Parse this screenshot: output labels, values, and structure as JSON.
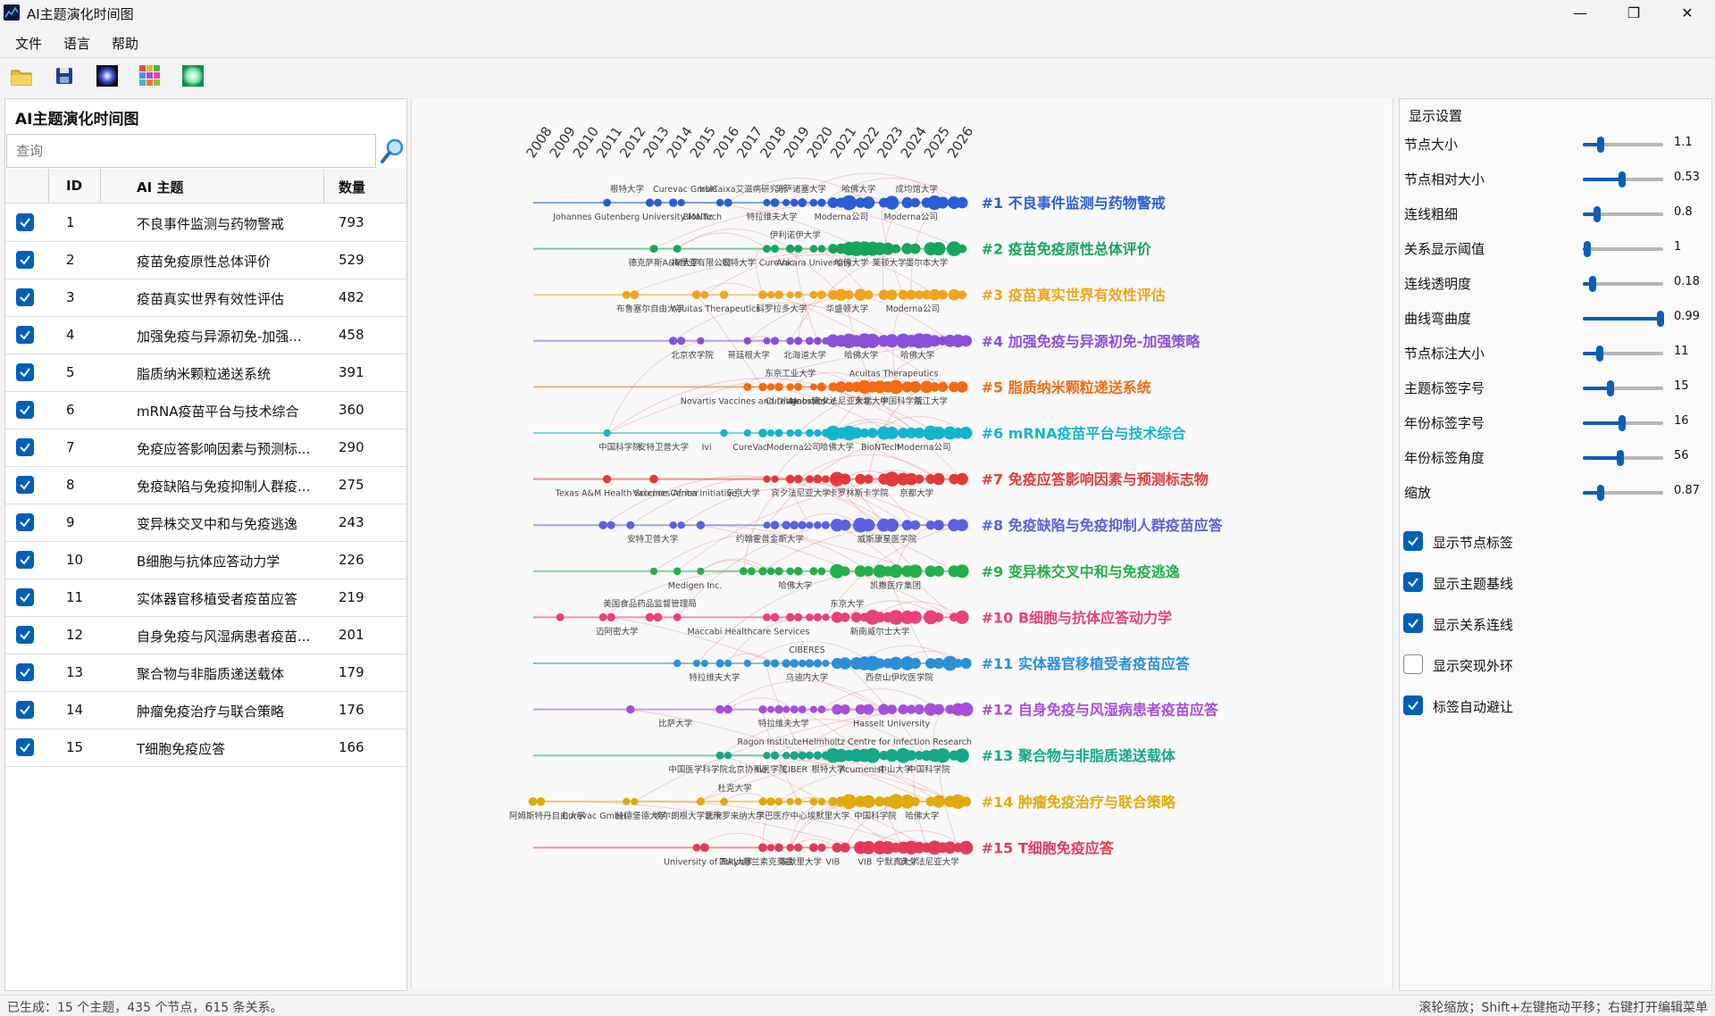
{
  "window": {
    "title": "AI主题演化时间图",
    "minimize": "—",
    "maximize": "❐",
    "close": "✕"
  },
  "menu": [
    "文件",
    "语言",
    "帮助"
  ],
  "toolbar": [
    "open-folder-icon",
    "save-icon",
    "dark-theme-icon",
    "color-palette-icon",
    "light-theme-icon"
  ],
  "left_panel": {
    "title": "AI主题演化时间图",
    "search_placeholder": "查询",
    "columns": [
      "ID",
      "AI 主题",
      "数量"
    ]
  },
  "topics": [
    {
      "id": "1",
      "name": "不良事件监测与药物警戒",
      "count": "793",
      "full": "不良事件监测与药物警戒",
      "color": "#2a5cd6",
      "checked": true
    },
    {
      "id": "2",
      "name": "疫苗免疫原性总体评价",
      "count": "529",
      "full": "疫苗免疫原性总体评价",
      "color": "#16a55a",
      "checked": true
    },
    {
      "id": "3",
      "name": "疫苗真实世界有效性评估",
      "count": "482",
      "full": "疫苗真实世界有效性评估",
      "color": "#f0a41c",
      "checked": true
    },
    {
      "id": "4",
      "name": "加强免疫与异源初免-加强...",
      "count": "458",
      "full": "加强免疫与异源初免-加强策略",
      "color": "#8a4fd8",
      "checked": true
    },
    {
      "id": "5",
      "name": "脂质纳米颗粒递送系统",
      "count": "391",
      "full": "脂质纳米颗粒递送系统",
      "color": "#f26a12",
      "checked": true
    },
    {
      "id": "6",
      "name": "mRNA疫苗平台与技术综合",
      "count": "360",
      "full": "mRNA疫苗平台与技术综合",
      "color": "#14b4cc",
      "checked": true
    },
    {
      "id": "7",
      "name": "免疫应答影响因素与预测标...",
      "count": "290",
      "full": "免疫应答影响因素与预测标志物",
      "color": "#e23a3a",
      "checked": true
    },
    {
      "id": "8",
      "name": "免疫缺陷与免疫抑制人群疫...",
      "count": "275",
      "full": "免疫缺陷与免疫抑制人群疫苗应答",
      "color": "#5b5fe0",
      "checked": true
    },
    {
      "id": "9",
      "name": "变异株交叉中和与免疫逃逸",
      "count": "243",
      "full": "变异株交叉中和与免疫逃逸",
      "color": "#22b04b",
      "checked": true
    },
    {
      "id": "10",
      "name": "B细胞与抗体应答动力学",
      "count": "226",
      "full": "B细胞与抗体应答动力学",
      "color": "#e8407a",
      "checked": true
    },
    {
      "id": "11",
      "name": "实体器官移植受者疫苗应答",
      "count": "219",
      "full": "实体器官移植受者疫苗应答",
      "color": "#2a8fd8",
      "checked": true
    },
    {
      "id": "12",
      "name": "自身免疫与风湿病患者疫苗...",
      "count": "201",
      "full": "自身免疫与风湿病患者疫苗应答",
      "color": "#a64fd8",
      "checked": true
    },
    {
      "id": "13",
      "name": "聚合物与非脂质递送载体",
      "count": "179",
      "full": "聚合物与非脂质递送载体",
      "color": "#15a88a",
      "checked": true
    },
    {
      "id": "14",
      "name": "肿瘤免疫治疗与联合策略",
      "count": "176",
      "full": "肿瘤免疫治疗与联合策略",
      "color": "#e0aa0c",
      "checked": true
    },
    {
      "id": "15",
      "name": "T细胞免疫应答",
      "count": "166",
      "full": "T细胞免疫应答",
      "color": "#e43a5a",
      "checked": true
    }
  ],
  "timeline": {
    "years": [
      "2008",
      "2009",
      "2010",
      "2011",
      "2012",
      "2013",
      "2014",
      "2015",
      "2016",
      "2017",
      "2018",
      "2019",
      "2020",
      "2021",
      "2022",
      "2023",
      "2024",
      "2025",
      "2026"
    ],
    "labels": [
      {
        "row": 1,
        "above": [
          "根特大学",
          "Curevac GmbH",
          "IrsiCaixa艾滋病研究所",
          "马萨诸塞大学",
          "哈佛大学",
          "成均馆大学"
        ],
        "below": [
          "Johannes Gutenberg University Mainz",
          "BioNTech",
          "特拉维夫大学",
          "Moderna公司",
          "Moderna公司"
        ]
      },
      {
        "row": 2,
        "above": [
          "伊利诺伊大学"
        ],
        "below": [
          "德克萨斯A&M大学",
          "梅里亚有限公司",
          "根特大学",
          "CureVac",
          "Ankara University",
          "哈佛大学",
          "莱顿大学",
          "墨尔本大学"
        ]
      },
      {
        "row": 3,
        "above": [],
        "below": [
          "布鲁塞尔自由大学",
          "Acuitas Therapeutics",
          "科罗拉多大学",
          "华盛顿大学",
          "Moderna公司"
        ]
      },
      {
        "row": 4,
        "above": [],
        "below": [
          "北京农学院",
          "哥廷根大学",
          "北海道大学",
          "哈佛大学",
          "哈佛大学"
        ]
      },
      {
        "row": 5,
        "above": [
          "东京工业大学",
          "Acuitas Therapeutics"
        ],
        "below": [
          "Novartis Vaccines and Diagnostics",
          "CureVac",
          "Mabxience",
          "宾夕法尼亚大学",
          "东北大学",
          "中国科学院",
          "浙江大学"
        ]
      },
      {
        "row": 6,
        "above": [],
        "below": [
          "中国科学院",
          "安特卫普大学",
          "Ivi",
          "CureVac",
          "Moderna公司",
          "哈佛大学",
          "BioNTech",
          "Moderna公司"
        ]
      },
      {
        "row": 7,
        "above": [],
        "below": [
          "Texas A&M Health Science Center",
          "Vaccines Africa Initiative",
          "东京大学",
          "宾夕法尼亚大学",
          "卡罗林斯卡学院",
          "京都大学"
        ]
      },
      {
        "row": 8,
        "above": [],
        "below": [
          "安特卫普大学",
          "约翰霍普金斯大学",
          "威斯康星医学院"
        ]
      },
      {
        "row": 9,
        "above": [],
        "below": [
          "Medigen Inc.",
          "哈佛大学",
          "凯撒医疗集团"
        ]
      },
      {
        "row": 10,
        "above": [
          "美国食品药品监督管理局",
          "东京大学"
        ],
        "below": [
          "迈阿密大学",
          "Maccabi Healthcare Services",
          "新南威尔士大学"
        ]
      },
      {
        "row": 11,
        "above": [
          "CIBERES"
        ],
        "below": [
          "特拉维夫大学",
          "乌迪内大学",
          "西奈山伊坎医学院"
        ]
      },
      {
        "row": 12,
        "above": [],
        "below": [
          "比萨大学",
          "特拉维夫大学",
          "Hasselt University"
        ]
      },
      {
        "row": 13,
        "above": [
          "Ragon Institute",
          "Helmholtz Centre for Infection Research"
        ],
        "below": [
          "中国医学科学院北京协和医学院",
          "Ivi",
          "CIBER",
          "根特大学",
          "Acumenist",
          "中山大学",
          "中国科学院"
        ]
      },
      {
        "row": 14,
        "above": [
          "杜克大学"
        ],
        "below": [
          "阿姆斯特丹自由大学",
          "Curevac GmbH",
          "拉德堡德大学",
          "埃尔朗根大学医院",
          "北卡罗来纳大学",
          "示巴医疗中心",
          "埃默里大学",
          "中国科学院",
          "哈佛大学"
        ]
      },
      {
        "row": 15,
        "above": [],
        "below": [
          "University of Tokyo",
          "四川大学",
          "慕兰素克莱兹",
          "埃默里大学",
          "VIB",
          "VIB",
          "宁默真大学",
          "宾夕法尼亚大学"
        ]
      }
    ]
  },
  "settings": {
    "title": "显示设置",
    "sliders": [
      {
        "label": "节点大小",
        "value": "1.1",
        "frac": 0.22
      },
      {
        "label": "节点相对大小",
        "value": "0.53",
        "frac": 0.49
      },
      {
        "label": "连线粗细",
        "value": "0.8",
        "frac": 0.18
      },
      {
        "label": "关系显示阈值",
        "value": "1",
        "frac": 0.06
      },
      {
        "label": "连线透明度",
        "value": "0.18",
        "frac": 0.12
      },
      {
        "label": "曲线弯曲度",
        "value": "0.99",
        "frac": 0.97
      },
      {
        "label": "节点标注大小",
        "value": "11",
        "frac": 0.21
      },
      {
        "label": "主题标签字号",
        "value": "15",
        "frac": 0.34
      },
      {
        "label": "年份标签字号",
        "value": "16",
        "frac": 0.49
      },
      {
        "label": "年份标签角度",
        "value": "56",
        "frac": 0.47
      },
      {
        "label": "缩放",
        "value": "0.87",
        "frac": 0.22
      }
    ],
    "checkboxes": [
      {
        "label": "显示节点标签",
        "checked": true
      },
      {
        "label": "显示主题基线",
        "checked": true
      },
      {
        "label": "显示关系连线",
        "checked": true
      },
      {
        "label": "显示突现外环",
        "checked": false
      },
      {
        "label": "标签自动避让",
        "checked": true
      }
    ]
  },
  "status": {
    "left": "已生成：15 个主题，435 个节点，615 条关系。",
    "right": "滚轮缩放；Shift+左键拖动平移；右键打开编辑菜单"
  }
}
